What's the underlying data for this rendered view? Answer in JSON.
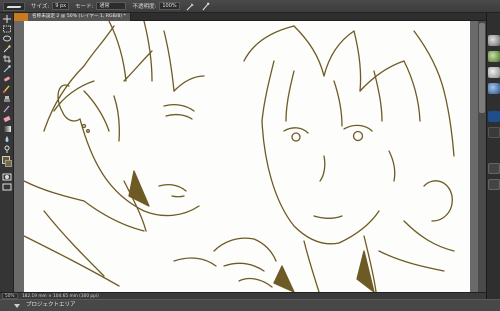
{
  "options_bar": {
    "size_label": "サイズ:",
    "size_value": "9 px",
    "mode_label": "モード:",
    "mode_value": "通常",
    "opacity_label": "不透明度:",
    "opacity_value": "100%"
  },
  "document_tab": {
    "title": "名称未設定 2 @ 50% (レイヤー 1, RGB/8) *"
  },
  "status_bar": {
    "zoom": "50%",
    "doc_info": "182.19 mm × 104.65 mm (300 ppi)"
  },
  "project_panel": {
    "label": "プロジェクトエリア"
  },
  "colors": {
    "foreground": "#6b5a2a",
    "background": "#7a6a3a",
    "line_art": "#6e5a24",
    "accent": "#c87a1e"
  },
  "tools": [
    "move-icon",
    "marquee-icon",
    "lasso-icon",
    "magic-wand-icon",
    "crop-icon",
    "eyedropper-icon",
    "healing-icon",
    "brush-icon",
    "clone-stamp-icon",
    "history-brush-icon",
    "eraser-icon",
    "gradient-icon",
    "blur-icon",
    "dodge-icon",
    "pen-icon",
    "type-icon",
    "path-select-icon",
    "shape-icon",
    "hand-icon",
    "zoom-icon"
  ]
}
